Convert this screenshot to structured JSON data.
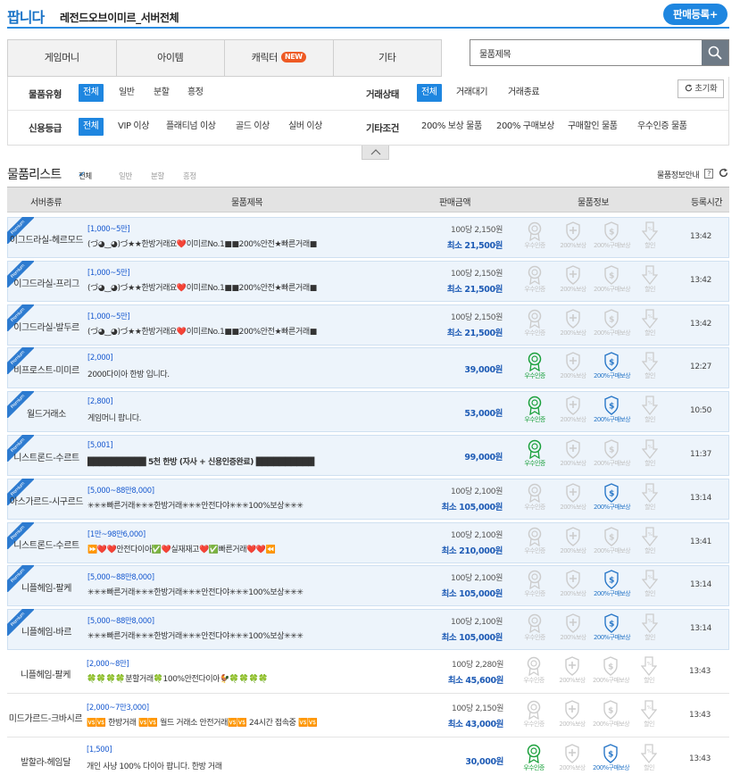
{
  "header": {
    "title": "팝니다",
    "subtitle": "레전드오브이미르_서버전체",
    "register_button": "판매등록+"
  },
  "tabs": [
    {
      "label": "게임머니"
    },
    {
      "label": "아이템"
    },
    {
      "label": "캐릭터",
      "badge": "NEW"
    },
    {
      "label": "기타"
    }
  ],
  "search": {
    "value": "물품제목"
  },
  "filters": {
    "item_type": {
      "label": "물품유형",
      "options": [
        "전체",
        "일반",
        "분할",
        "흥정"
      ],
      "selected": "전체"
    },
    "trade_status": {
      "label": "거래상태",
      "options": [
        "전체",
        "거래대기",
        "거래종료"
      ],
      "selected": "전체"
    },
    "reset": "초기화",
    "credit": {
      "label": "신용등급",
      "options": [
        "전체",
        "VIP 이상",
        "플래티넘 이상",
        "골드 이상",
        "실버 이상"
      ],
      "selected": "전체"
    },
    "other": {
      "label": "기타조건",
      "options": [
        "200% 보상 물품",
        "200% 구매보상",
        "구매할인 물품",
        "우수인증 물품"
      ]
    }
  },
  "list": {
    "title": "물품리스트",
    "filters": [
      "전체",
      "일반",
      "분할",
      "흥정"
    ],
    "selected": "전체",
    "guide": "물품정보안내",
    "help": "?"
  },
  "columns": [
    "서버종류",
    "물품제목",
    "판매금액",
    "물품정보",
    "등록시간"
  ],
  "badge_labels": [
    "우수인증",
    "200%보상",
    "200%구매보상",
    "할인"
  ],
  "ribbon": "Premium",
  "rows": [
    {
      "premium": true,
      "server": "이그드라실-헤르모드",
      "range": "[1,000~5만]",
      "desc": "(づ◕‿◕)づ★★한방거래요❤️이미르No.1■■200%안전★빠른거래■",
      "rate": "100당 2,150원",
      "price": "최소 21,500원",
      "cert": false,
      "buy": false,
      "time": "13:42"
    },
    {
      "premium": true,
      "server": "이그드라실-프리그",
      "range": "[1,000~5만]",
      "desc": "(づ◕‿◕)づ★★한방거래요❤️이미르No.1■■200%안전★빠른거래■",
      "rate": "100당 2,150원",
      "price": "최소 21,500원",
      "cert": false,
      "buy": false,
      "time": "13:42"
    },
    {
      "premium": true,
      "server": "이그드라실-발두르",
      "range": "[1,000~5만]",
      "desc": "(づ◕‿◕)づ★★한방거래요❤️이미르No.1■■200%안전★빠른거래■",
      "rate": "100당 2,150원",
      "price": "최소 21,500원",
      "cert": false,
      "buy": false,
      "time": "13:42"
    },
    {
      "premium": true,
      "server": "비프로스트-미미르",
      "range": "[2,000]",
      "desc": "2000다이아 한방 입니다.",
      "rate": "",
      "price": "39,000원",
      "cert": true,
      "buy": true,
      "time": "12:27"
    },
    {
      "premium": true,
      "server": "월드거래소",
      "range": "[2,800]",
      "desc": "게임머니 팝니다.",
      "rate": "",
      "price": "53,000원",
      "cert": true,
      "buy": true,
      "time": "10:50"
    },
    {
      "premium": true,
      "server": "니스트론드-수르트",
      "range": "[5,001]",
      "desc": "██████████ 5천 한방 (자사 + 신용인증완료) ██████████",
      "rate": "",
      "price": "99,000원",
      "cert": true,
      "buy": false,
      "time": "11:37",
      "bold": true
    },
    {
      "premium": true,
      "server": "아스가르드-시구르드",
      "range": "[5,000~88만8,000]",
      "desc": "✳✳✳빠른거래✳✳✳한방거래✳✳✳안전다야✳✳✳100%보상✳✳✳",
      "rate": "100당 2,100원",
      "price": "최소 105,000원",
      "cert": false,
      "buy": true,
      "time": "13:14"
    },
    {
      "premium": true,
      "server": "니스트론드-수르트",
      "range": "[1만~98만6,000]",
      "desc": "⏩❤️❤️안전다이아✅❤️실재재고❤️✅빠른거래❤️❤️⏪",
      "rate": "100당 2,100원",
      "price": "최소 210,000원",
      "cert": false,
      "buy": false,
      "time": "13:41"
    },
    {
      "premium": true,
      "server": "니플헤임-팔케",
      "range": "[5,000~88만8,000]",
      "desc": "✳✳✳빠른거래✳✳✳한방거래✳✳✳안전다야✳✳✳100%보상✳✳✳",
      "rate": "100당 2,100원",
      "price": "최소 105,000원",
      "cert": false,
      "buy": true,
      "time": "13:14"
    },
    {
      "premium": true,
      "server": "니플헤임-바르",
      "range": "[5,000~88만8,000]",
      "desc": "✳✳✳빠른거래✳✳✳한방거래✳✳✳안전다야✳✳✳100%보상✳✳✳",
      "rate": "100당 2,100원",
      "price": "최소 105,000원",
      "cert": false,
      "buy": true,
      "time": "13:14"
    },
    {
      "premium": false,
      "server": "니플헤임-팔케",
      "range": "[2,000~8만]",
      "desc": "🍀🍀🍀🍀분할거래🍀100%안전다이아🐓🍀🍀🍀🍀",
      "rate": "100당 2,280원",
      "price": "최소 45,600원",
      "cert": false,
      "buy": false,
      "time": "13:43"
    },
    {
      "premium": false,
      "server": "미드가르드-크바시르",
      "range": "[2,000~7만3,000]",
      "desc": "🆚🆚 한방거래 🆚🆚 월드 거래소 안전거래🆚🆚 24시간 접속중 🆚🆚",
      "rate": "100당 2,150원",
      "price": "최소 43,000원",
      "cert": false,
      "buy": false,
      "time": "13:43"
    },
    {
      "premium": false,
      "server": "발할라-헤임달",
      "range": "[1,500]",
      "desc": "개인 사냥 100% 다이아 팝니다. 한방 거래",
      "rate": "",
      "price": "30,000원",
      "cert": true,
      "buy": true,
      "time": "13:43"
    }
  ]
}
